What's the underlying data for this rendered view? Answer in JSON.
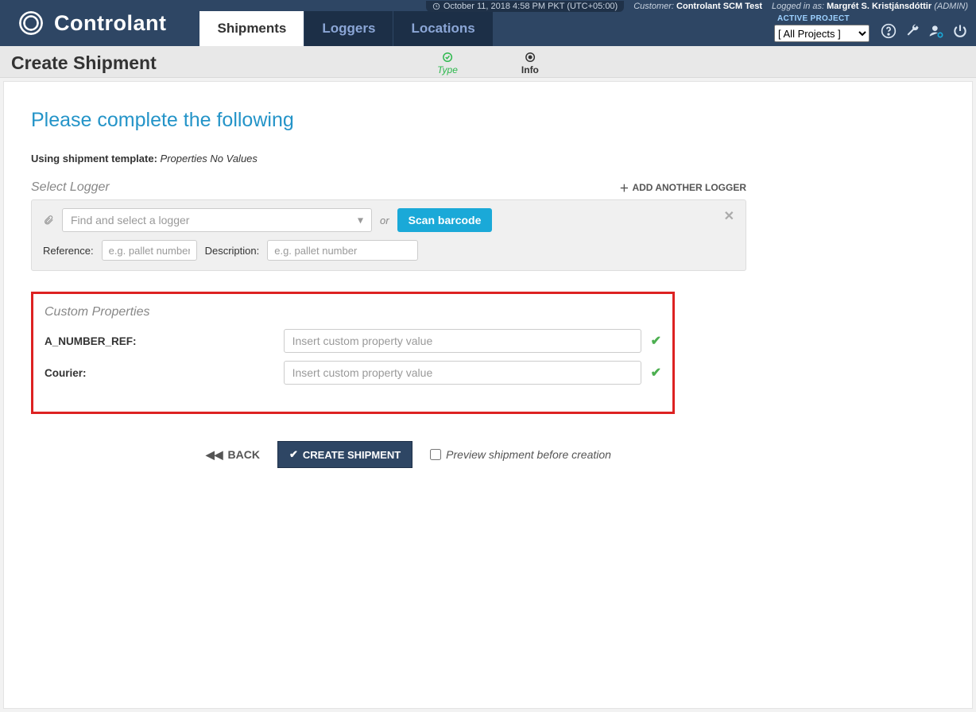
{
  "topbar": {
    "datetime": "October 11, 2018 4:58 PM PKT (UTC+05:00)",
    "customer_label": "Customer:",
    "customer_name": "Controlant SCM Test",
    "loggedin_label": "Logged in as:",
    "user_name": "Margrét S. Kristjánsdóttir",
    "user_role": "(ADMIN)",
    "brand": "Controlant",
    "tabs": {
      "shipments": "Shipments",
      "loggers": "Loggers",
      "locations": "Locations"
    },
    "active_project_label": "ACTIVE PROJECT",
    "project_selected": "[ All Projects ]"
  },
  "subheader": {
    "title": "Create Shipment",
    "step_type": "Type",
    "step_info": "Info"
  },
  "main": {
    "heading": "Please complete the following",
    "template_label": "Using shipment template:",
    "template_value": "Properties No Values",
    "logger": {
      "section_title": "Select Logger",
      "add_another": "ADD ANOTHER LOGGER",
      "find_placeholder": "Find and select a logger",
      "or": "or",
      "scan": "Scan barcode",
      "reference_label": "Reference:",
      "reference_placeholder": "e.g. pallet number",
      "description_label": "Description:",
      "description_placeholder": "e.g. pallet number"
    },
    "custom": {
      "section_title": "Custom Properties",
      "props": [
        {
          "label": "A_NUMBER_REF:",
          "placeholder": "Insert custom property value"
        },
        {
          "label": "Courier:",
          "placeholder": "Insert custom property value"
        }
      ]
    },
    "actions": {
      "back": "BACK",
      "create": "CREATE SHIPMENT",
      "preview": "Preview shipment before creation"
    }
  }
}
